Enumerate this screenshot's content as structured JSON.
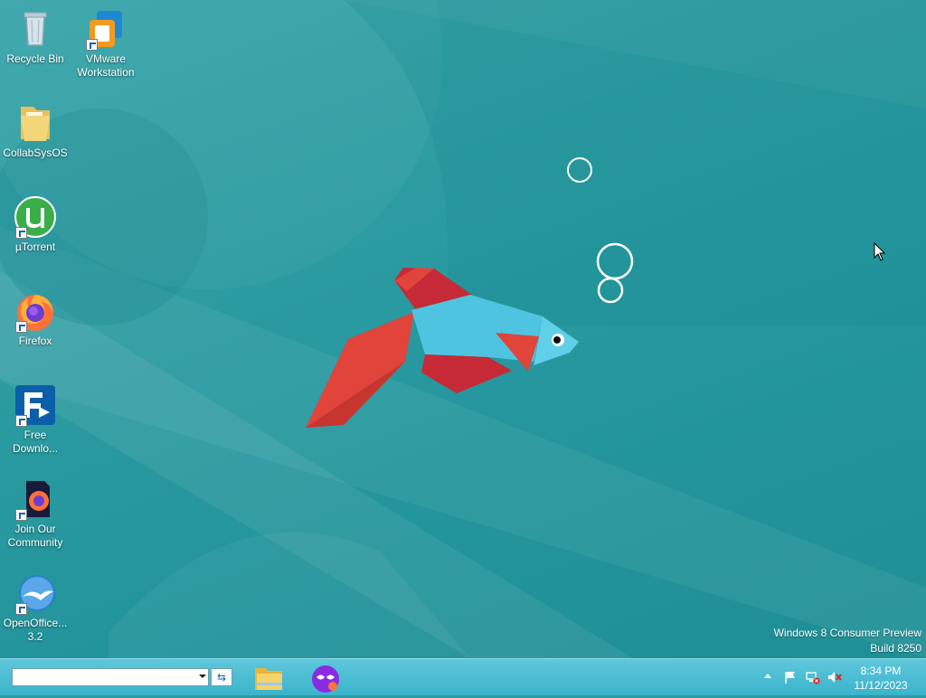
{
  "desktop": {
    "icons": [
      {
        "label": "Recycle Bin",
        "icon": "recycle-bin-icon"
      },
      {
        "label": "VMware Workstation",
        "icon": "vmware-icon"
      },
      {
        "label": "CollabSysOS",
        "icon": "folder-icon"
      },
      {
        "label": "µTorrent",
        "icon": "utorrent-icon"
      },
      {
        "label": "Firefox",
        "icon": "firefox-icon"
      },
      {
        "label": "Free Downlo...",
        "icon": "free-download-manager-icon"
      },
      {
        "label": "Join Our Community",
        "icon": "firefox-private-icon"
      },
      {
        "label": "OpenOffice... 3.2",
        "icon": "openoffice-icon"
      }
    ],
    "watermark": {
      "line1": "Windows 8 Consumer Preview",
      "line2": "Build 8250"
    }
  },
  "taskbar": {
    "address_value": "",
    "go_glyph": "⇆",
    "apps": [
      {
        "name": "File Explorer",
        "icon": "file-explorer-icon"
      },
      {
        "name": "Firefox Private Browsing",
        "icon": "private-browsing-icon"
      }
    ],
    "tray": {
      "icons": [
        "show-hidden-icons",
        "action-center-flag-icon",
        "network-disconnected-icon",
        "volume-muted-icon"
      ]
    },
    "clock": {
      "time": "8:34 PM",
      "date": "11/12/2023"
    }
  },
  "colors": {
    "wallpaper": "#2a9ba1",
    "taskbar": "#4bbfd6",
    "fish_body": "#4fc4e0",
    "fish_fin_red": "#c62a36",
    "fish_tail": "#e0443a"
  }
}
